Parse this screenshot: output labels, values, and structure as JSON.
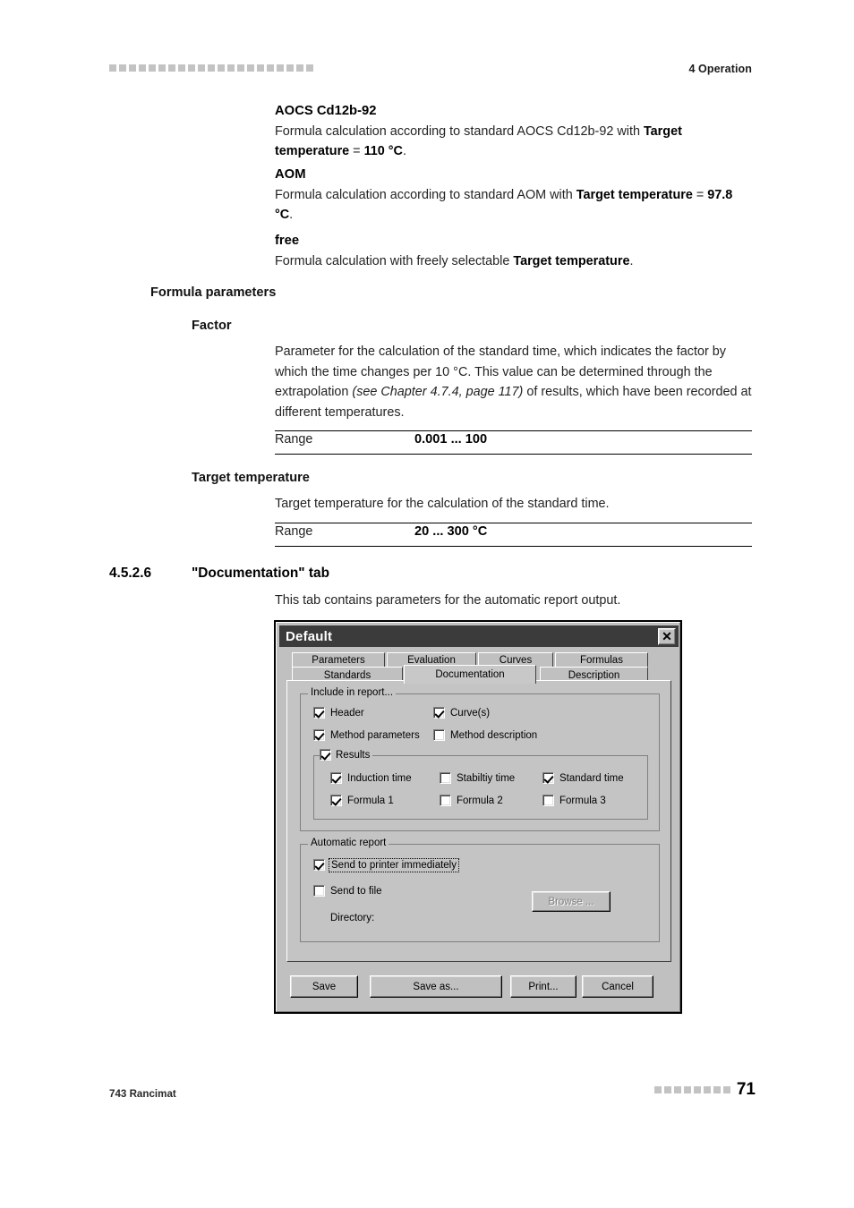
{
  "page": {
    "header": {
      "chapter": "4 Operation",
      "decor_squares": 21
    },
    "footer": {
      "product": "743 Rancimat",
      "page_number": "71",
      "decor_squares": 8
    }
  },
  "content": {
    "standards": [
      {
        "name": "AOCS Cd12b-92",
        "desc_pre": "Formula calculation according to standard AOCS Cd12b-92 with ",
        "desc_bold": "Target temperature",
        "desc_mid": " = ",
        "desc_value": "110 °C",
        "desc_post": "."
      },
      {
        "name": "AOM",
        "desc_pre": "Formula calculation according to standard AOM with ",
        "desc_bold": "Target temperature",
        "desc_mid": " = ",
        "desc_value": "97.8 °C",
        "desc_post": "."
      },
      {
        "name": "free",
        "desc_pre": "Formula calculation with freely selectable ",
        "desc_bold": "Target temperature",
        "desc_mid": "",
        "desc_value": "",
        "desc_post": "."
      }
    ],
    "formula_parameters_heading": "Formula parameters",
    "factor": {
      "label": "Factor",
      "text_1": "Parameter for the calculation of the standard time, which indicates the factor by which the time changes per 10 °C. This value can be determined through the extrapolation ",
      "cross_ref": "(see Chapter 4.7.4, page 117)",
      "text_2": " of results, which have been recorded at different temperatures.",
      "range_key": "Range",
      "range_value": "0.001 ... 100"
    },
    "target_temperature": {
      "label": "Target temperature",
      "text": "Target temperature for the calculation of the standard time.",
      "range_key": "Range",
      "range_value": "20 ... 300 °C"
    },
    "section": {
      "number": "4.5.2.6",
      "title": "\"Documentation\" tab",
      "intro": "This tab contains parameters for the automatic report output."
    }
  },
  "dialog": {
    "title": "Default",
    "close_icon": "close-x-icon",
    "tabs_row1": [
      {
        "label": "Parameters",
        "active": false
      },
      {
        "label": "Evaluation",
        "active": false
      },
      {
        "label": "Curves",
        "active": false
      },
      {
        "label": "Formulas",
        "active": false
      }
    ],
    "tabs_row2": [
      {
        "label": "Standards",
        "active": false
      },
      {
        "label": "Documentation",
        "active": true
      },
      {
        "label": "Description",
        "active": false
      }
    ],
    "include_group": {
      "title": "Include in report...",
      "checks": [
        {
          "label": "Header",
          "checked": true
        },
        {
          "label": "Curve(s)",
          "checked": true
        },
        {
          "label": "Method parameters",
          "checked": true
        },
        {
          "label": "Method description",
          "checked": false
        }
      ]
    },
    "results_group": {
      "title": "Results",
      "title_checked": true,
      "checks": [
        {
          "label": "Induction time",
          "checked": true
        },
        {
          "label": "Stabiltiy time",
          "checked": false
        },
        {
          "label": "Standard time",
          "checked": true
        },
        {
          "label": "Formula 1",
          "checked": true
        },
        {
          "label": "Formula 2",
          "checked": false
        },
        {
          "label": "Formula 3",
          "checked": false
        }
      ]
    },
    "automatic_group": {
      "title": "Automatic report",
      "send_printer": {
        "label": "Send to printer immediately",
        "checked": true,
        "focused": true
      },
      "send_file": {
        "label": "Send to file",
        "checked": false
      },
      "directory_label": "Directory:",
      "directory_value": "",
      "browse_button": {
        "label": "Browse ...",
        "disabled": true
      }
    },
    "footer_buttons": [
      {
        "label": "Save"
      },
      {
        "label": "Save as..."
      },
      {
        "label": "Print..."
      },
      {
        "label": "Cancel"
      }
    ]
  }
}
